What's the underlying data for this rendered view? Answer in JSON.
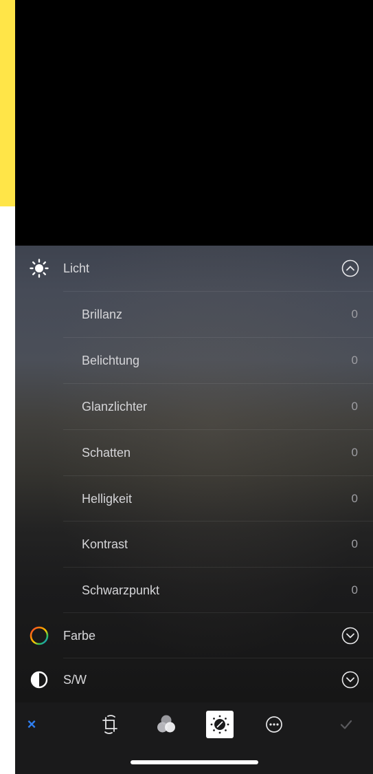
{
  "sections": {
    "light": {
      "label": "Licht",
      "icon": "sun-icon",
      "state": "expanded",
      "sliders": [
        {
          "label": "Brillanz",
          "value": "0"
        },
        {
          "label": "Belichtung",
          "value": "0"
        },
        {
          "label": "Glanzlichter",
          "value": "0"
        },
        {
          "label": "Schatten",
          "value": "0"
        },
        {
          "label": "Helligkeit",
          "value": "0"
        },
        {
          "label": "Kontrast",
          "value": "0"
        },
        {
          "label": "Schwarzpunkt",
          "value": "0"
        }
      ]
    },
    "color": {
      "label": "Farbe",
      "icon": "color-ring-icon",
      "state": "collapsed"
    },
    "bw": {
      "label": "S/W",
      "icon": "contrast-half-circle-icon",
      "state": "collapsed"
    }
  },
  "toolbar": {
    "cancel_label": "×",
    "items": [
      "crop-rotate-icon",
      "filters-icon",
      "adjust-icon",
      "more-icon",
      "done-checkmark-icon"
    ],
    "active_item": "adjust-icon"
  },
  "colors": {
    "background_accent": "#ffe548",
    "cancel": "#2f7ff0",
    "panel_text": "#d9d9dc",
    "value_text": "#9e9ea3",
    "toolbar_bg": "#1a1a1b"
  }
}
